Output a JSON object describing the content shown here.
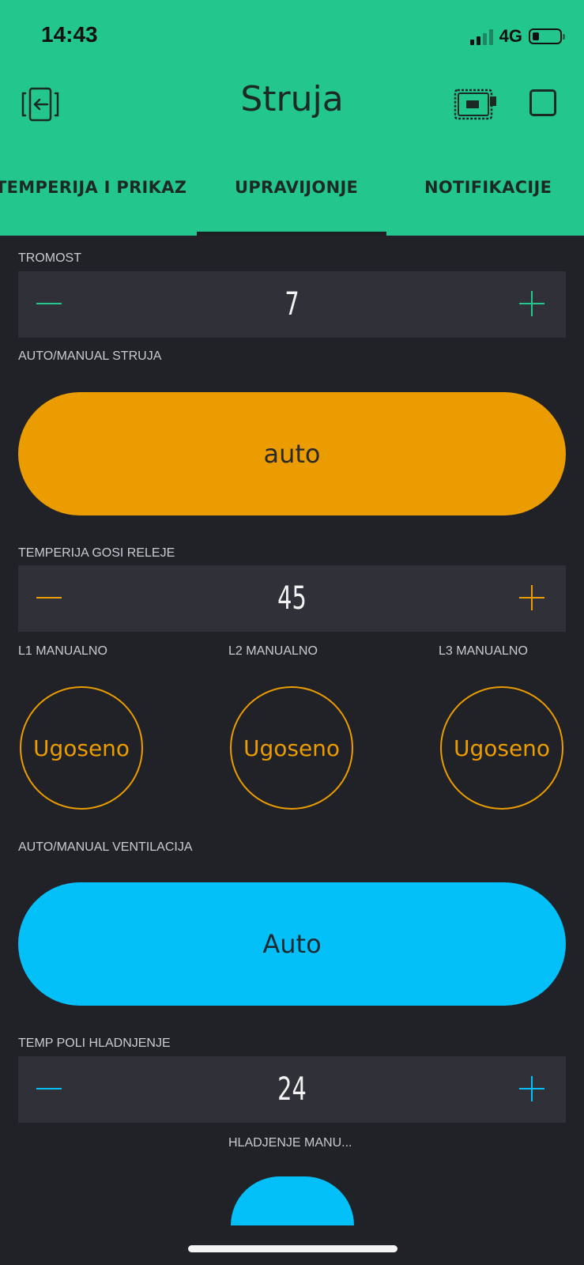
{
  "status_bar": {
    "time": "14:43",
    "network": "4G"
  },
  "header": {
    "title": "Struja"
  },
  "tabs": [
    {
      "label": "TEMPERIJA I PRIKAZ"
    },
    {
      "label": "UPRAVIJONJE"
    },
    {
      "label": "NOTIFIKACIJE"
    }
  ],
  "widgets": {
    "tromost": {
      "label": "TROMOST",
      "value": "7"
    },
    "auto_manual_struja": {
      "label": "AUTO/MANUAL STRUJA",
      "button": "auto"
    },
    "temperija_gosi": {
      "label": "TEMPERIJA GOSI RELEJE",
      "value": "45"
    },
    "l1": {
      "label": "L1 MANUALNO",
      "button": "Ugoseno"
    },
    "l2": {
      "label": "L2 MANUALNO",
      "button": "Ugoseno"
    },
    "l3": {
      "label": "L3 MANUALNO",
      "button": "Ugoseno"
    },
    "auto_manual_ventilacija": {
      "label": "AUTO/MANUAL VENTILACIJA",
      "button": "Auto"
    },
    "temp_poli": {
      "label": "TEMP POLI HLADNJENJE",
      "value": "24"
    },
    "hladjenje": {
      "label": "HLADJENJE MANU..."
    }
  },
  "colors": {
    "header": "#23c78e",
    "orange": "#eb9c00",
    "blue": "#04c0f8",
    "background": "#212227"
  }
}
